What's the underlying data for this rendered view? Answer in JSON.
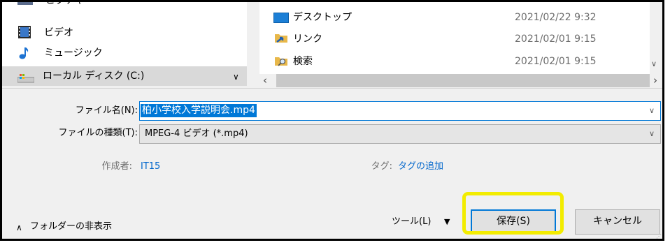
{
  "nav_items": [
    {
      "label": "ビデオ",
      "icon": "video-folder-icon"
    },
    {
      "label": "ミュージック",
      "icon": "music-note-icon"
    },
    {
      "label": "ローカル ディスク (C:)",
      "icon": "local-disk-icon"
    }
  ],
  "partial_nav_label": "ピクチャ",
  "files": [
    {
      "name": "デスクトップ",
      "date": "2021/02/22 9:32",
      "icon": "desktop-folder-icon"
    },
    {
      "name": "リンク",
      "date": "2021/02/01 9:15",
      "icon": "links-folder-icon"
    },
    {
      "name": "検索",
      "date": "2021/02/01 9:15",
      "icon": "search-folder-icon"
    }
  ],
  "form": {
    "filename_label": "ファイル名(N):",
    "filename_value": "柏小学校入学説明会.mp4",
    "filetype_label": "ファイルの種類(T):",
    "filetype_value": "MPEG-4 ビデオ (*.mp4)",
    "author_label": "作成者:",
    "author_value": "IT15",
    "tag_label": "タグ:",
    "tag_value": "タグの追加"
  },
  "footer": {
    "hide_folders": "フォルダーの非表示",
    "tools": "ツール(L)",
    "save": "保存(S)",
    "cancel": "キャンセル"
  },
  "highlight_color": "#f2ec00",
  "accent_color": "#0078d7"
}
